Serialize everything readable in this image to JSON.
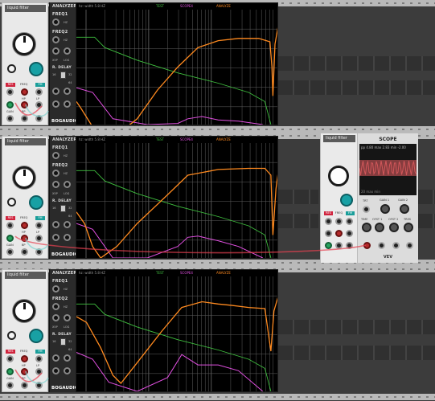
{
  "modules": {
    "liquid_filter": {
      "title": "liquid filter",
      "labels": {
        "res": "RES",
        "freq": "FREQ",
        "fm": "FM",
        "gain": "GAIN",
        "hp": "HP",
        "bp": "BP",
        "lp": "LP"
      }
    },
    "analyzer": {
      "title": "ANALYZER",
      "freq1": "FREQ1",
      "freq2": "FREQ2",
      "hz": "HZ",
      "log": "LOG",
      "xsp": "X5P",
      "delay": "R. DELAY",
      "d_val1": "16",
      "d_val2": "32",
      "d_val3": "64",
      "brand_a": "BOG",
      "brand_b": "AUDIO",
      "header_info": "hz: width 5.8 HZ",
      "legend": {
        "a": "TEST",
        "b": "SCOPE4",
        "c": "ANALYZE"
      }
    },
    "scope": {
      "title": "SCOPE",
      "readout": "pp  4.80 max  2.83 min -2.00",
      "bottom_readout": "20        max       min",
      "knobs": [
        "TIME",
        "OFST 1",
        "OFST 2",
        "TRES"
      ],
      "gains": [
        "GAIN 1",
        "GAIN 2"
      ],
      "brand": "VEV",
      "trace_color": "#d1575a"
    }
  },
  "colors": {
    "green": "#3fbf3f",
    "magenta": "#e04fe0",
    "orange": "#ff8a1f",
    "grid": "#5f5f5f",
    "accent_red": "#d0233d",
    "accent_teal": "#18a0a4"
  }
}
